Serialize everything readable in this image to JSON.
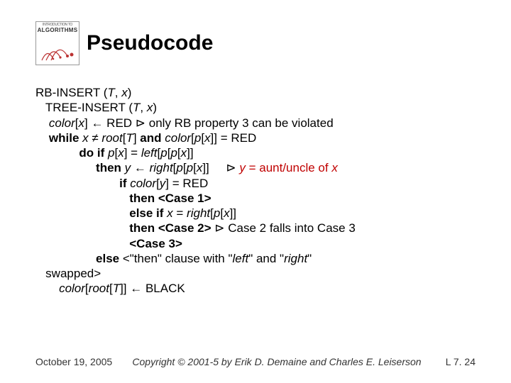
{
  "title": "Pseudocode",
  "code": {
    "l1_proc": "RB-INSERT",
    "l1_args_open": " (",
    "l1_T": "T",
    "l1_sep": ", ",
    "l1_x": "x",
    "l1_close": ")",
    "l2_proc": "TREE-INSERT",
    "l2_args_open": " (",
    "l2_T": "T",
    "l2_sep": ", ",
    "l2_x": "x",
    "l2_close": ")",
    "l3_color": "color",
    "l3_br1": "[",
    "l3_x": "x",
    "l3_br2": "] ← RED ",
    "l3_tri": "⊳",
    "l3_comment": " only RB property 3 can be violated",
    "l4_while": "while ",
    "l4_x": "x",
    "l4_ne": " ≠ ",
    "l4_root": "root",
    "l4_br1": "[",
    "l4_T": "T",
    "l4_br2": "] ",
    "l4_and": "and ",
    "l4_color": "color",
    "l4_br3": "[",
    "l4_p": "p",
    "l4_br4": "[",
    "l4_x2": "x",
    "l4_br5": "]] = RED",
    "l5_do_if": "do if ",
    "l5_p": "p",
    "l5_br1": "[",
    "l5_x": "x",
    "l5_br2": "] = ",
    "l5_left": "left",
    "l5_br3": "[",
    "l5_p2": "p",
    "l5_br4": "[",
    "l5_p3": "p",
    "l5_br5": "[",
    "l5_x2": "x",
    "l5_br6": "]]",
    "l6_then": "then ",
    "l6_y": "y",
    "l6_arrow": " ← ",
    "l6_right": "right",
    "l6_br1": "[",
    "l6_p": "p",
    "l6_br2": "[",
    "l6_p2": "p",
    "l6_br3": "[",
    "l6_x": "x",
    "l6_br4": "]]     ",
    "l6_tri": "⊳",
    "l6_sp": " ",
    "l6_y2": "y",
    "l6_comment": " = aunt/uncle of ",
    "l6_x2": "x",
    "l7_if": "if ",
    "l7_color": "color",
    "l7_br1": "[",
    "l7_y": "y",
    "l7_br2": "] = RED",
    "l8_then": "then <Case 1>",
    "l9_else_if": "else if ",
    "l9_x": "x",
    "l9_eq": " = ",
    "l9_right": "right",
    "l9_br1": "[",
    "l9_p": "p",
    "l9_br2": "[",
    "l9_x2": "x",
    "l9_br3": "]]",
    "l10_then": "then <Case 2> ",
    "l10_tri": "⊳",
    "l10_comment": " Case 2 falls into Case 3",
    "l11_case3": "<Case 3>",
    "l12_else": "else ",
    "l12_comment1": "<\"then\" clause with \"",
    "l12_left": "left",
    "l12_comment2": "\" and \"",
    "l12_right": "right",
    "l12_comment3": "\"",
    "l13_swapped": "swapped>",
    "l14_color": "color",
    "l14_br1": "[",
    "l14_root": "root",
    "l14_br2": "[",
    "l14_T": "T",
    "l14_br3": "]] ← BLACK"
  },
  "footer": {
    "date": "October 19, 2005",
    "copyright": "Copyright © 2001-5 by Erik D. Demaine and Charles E. Leiserson",
    "pagenum": "L 7. 24"
  }
}
